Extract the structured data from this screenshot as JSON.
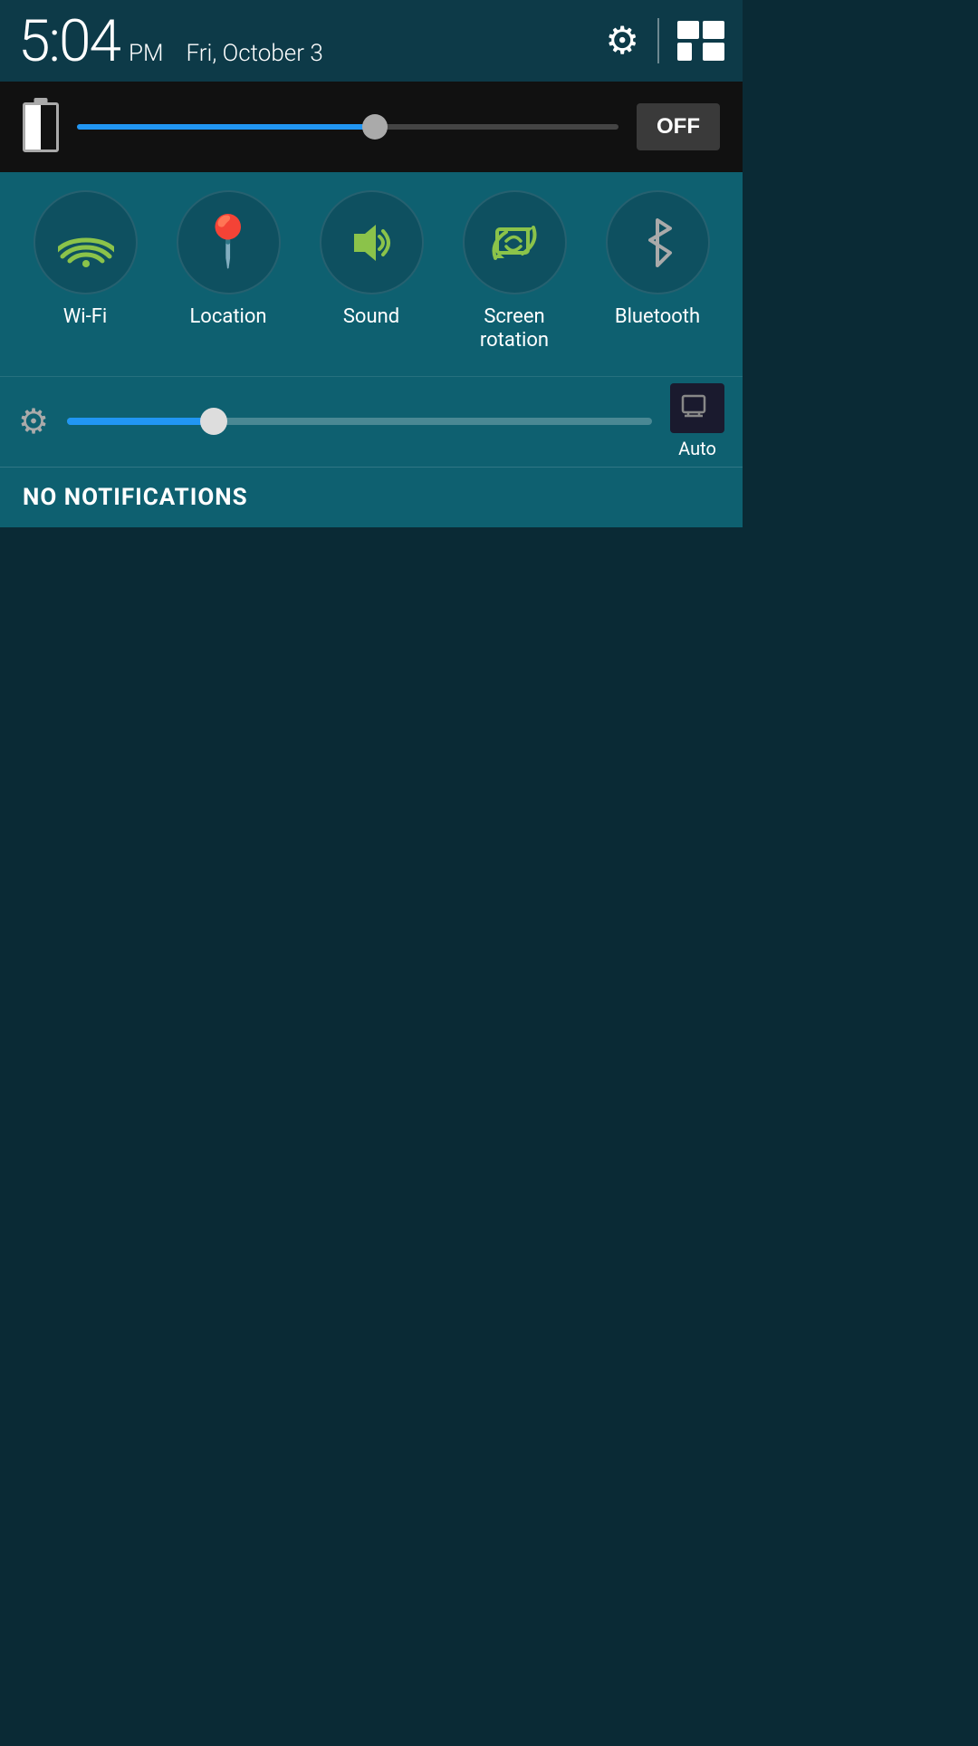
{
  "statusBar": {
    "time": "5:04",
    "ampm": "PM",
    "date": "Fri, October 3",
    "settingsLabel": "settings",
    "multiWindowLabel": "multi-window"
  },
  "brightnessPanel": {
    "offLabel": "OFF",
    "sliderPercent": 55
  },
  "quickSettings": {
    "items": [
      {
        "id": "wifi",
        "label": "Wi-Fi",
        "active": true
      },
      {
        "id": "location",
        "label": "Location",
        "active": true
      },
      {
        "id": "sound",
        "label": "Sound",
        "active": true
      },
      {
        "id": "screen-rotation",
        "label": "Screen\nrotation",
        "active": true
      },
      {
        "id": "bluetooth",
        "label": "Bluetooth",
        "active": false
      }
    ]
  },
  "brightnessPanel2": {
    "sliderPercent": 25,
    "autoLabel": "Auto"
  },
  "notifications": {
    "emptyLabel": "NO NOTIFICATIONS"
  },
  "colors": {
    "accent": "#8bc34a",
    "panelBg": "#0e6070",
    "statusBg": "#0d3a48",
    "sliderBlue": "#2196F3",
    "darkBg": "#0a2a35"
  }
}
